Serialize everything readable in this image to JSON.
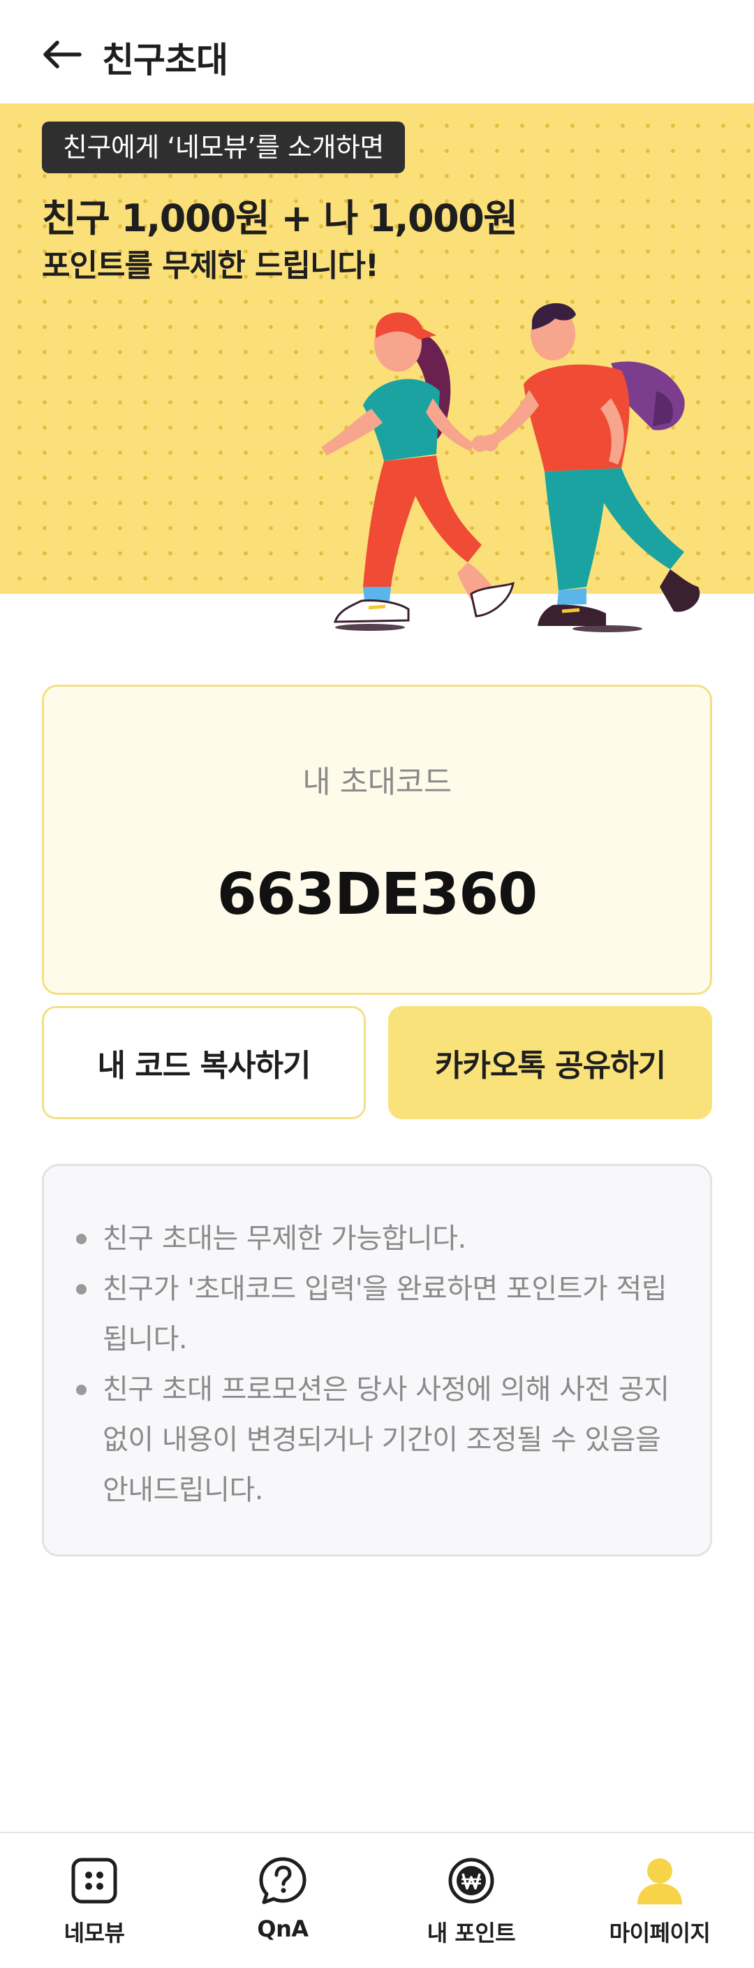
{
  "header": {
    "title": "친구초대",
    "back_icon": "arrow-left-icon"
  },
  "banner": {
    "tag": "친구에게 ‘네모뷰’를 소개하면",
    "headline": "친구 1,000원 + 나 1,000원",
    "subline": "포인트를 무제한 드립니다!",
    "background_color": "#fbe07a"
  },
  "code_card": {
    "label": "내 초대코드",
    "code": "663DE360"
  },
  "buttons": {
    "copy_label": "내 코드 복사하기",
    "kakao_label": "카카오톡 공유하기",
    "kakao_color": "#fae27a"
  },
  "notice": {
    "items": [
      "친구 초대는 무제한 가능합니다.",
      "친구가 '초대코드 입력'을 완료하면 포인트가 적립됩니다.",
      "친구 초대 프로모션은 당사 사정에 의해 사전 공지 없이 내용이 변경되거나 기간이 조정될 수 있음을 안내드립니다."
    ]
  },
  "bottom_nav": {
    "items": [
      {
        "label": "네모뷰",
        "icon": "grid-dots-icon"
      },
      {
        "label": "QnA",
        "icon": "question-bubble-icon"
      },
      {
        "label": "내 포인트",
        "icon": "won-coin-icon"
      },
      {
        "label": "마이페이지",
        "icon": "user-icon",
        "active": true
      }
    ],
    "active_color": "#f7d34a"
  }
}
